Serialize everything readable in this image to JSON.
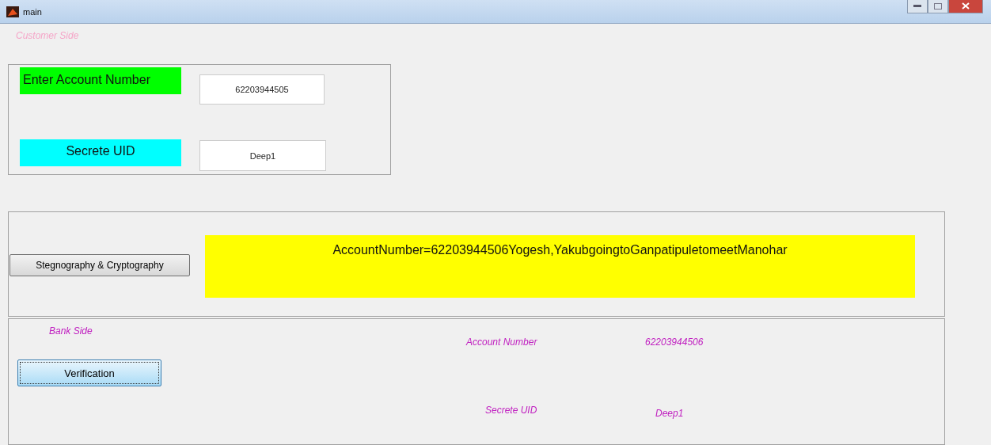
{
  "window": {
    "title": "main"
  },
  "customer_side": {
    "heading": "Customer  Side",
    "account_label": "Enter Account Number",
    "account_value": "62203944505",
    "uid_label": "Secrete  UID",
    "uid_value": "Deep1"
  },
  "process": {
    "button": "Stegnography & Cryptography",
    "output": "AccountNumber=62203944506Yogesh,YakubgoingtoGanpatipuletomeetManohar"
  },
  "bank_side": {
    "heading": "Bank  Side",
    "button": "Verification",
    "account_label": "Account Number",
    "account_value": "62203944506",
    "uid_label": "Secrete  UID",
    "uid_value": "Deep1"
  }
}
